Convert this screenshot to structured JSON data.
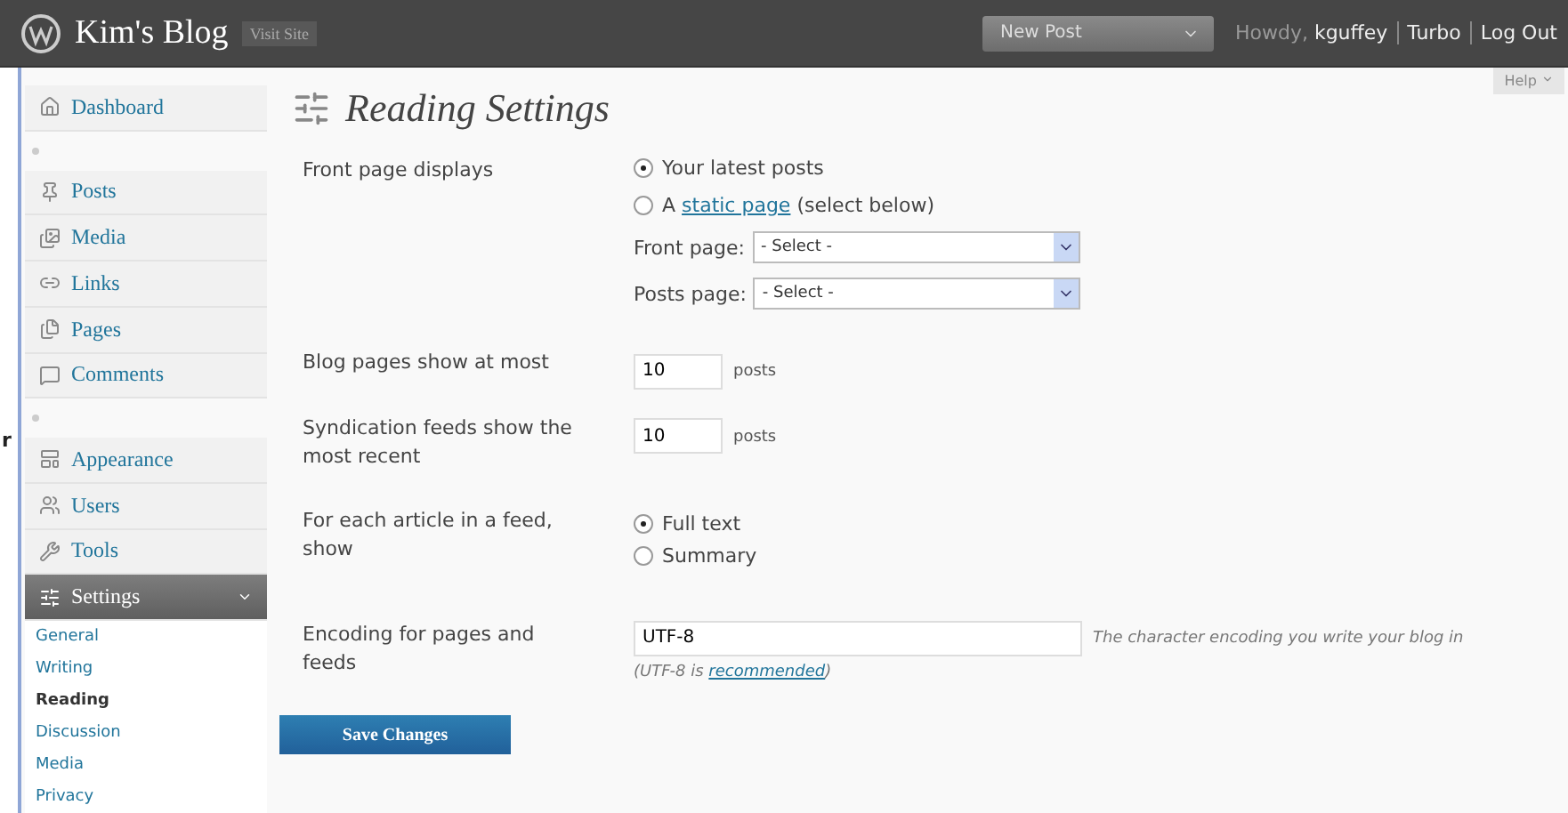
{
  "header": {
    "site_title": "Kim's Blog",
    "visit_site": "Visit Site",
    "new_post": "New Post",
    "howdy": "Howdy, ",
    "user": "kguffey",
    "turbo": "Turbo",
    "logout": "Log Out"
  },
  "edge_text": "r",
  "help": "Help",
  "sidebar": {
    "groups": [
      [
        {
          "label": "Dashboard",
          "selected": false
        }
      ],
      [
        {
          "label": "Posts",
          "selected": false
        },
        {
          "label": "Media",
          "selected": false
        },
        {
          "label": "Links",
          "selected": false
        },
        {
          "label": "Pages",
          "selected": false
        },
        {
          "label": "Comments",
          "selected": false
        }
      ],
      [
        {
          "label": "Appearance",
          "selected": false
        },
        {
          "label": "Users",
          "selected": false
        },
        {
          "label": "Tools",
          "selected": false
        },
        {
          "label": "Settings",
          "selected": true,
          "expanded": true,
          "children": [
            {
              "label": "General",
              "selected": false
            },
            {
              "label": "Writing",
              "selected": false
            },
            {
              "label": "Reading",
              "selected": true
            },
            {
              "label": "Discussion",
              "selected": false
            },
            {
              "label": "Media",
              "selected": false
            },
            {
              "label": "Privacy",
              "selected": false
            }
          ]
        }
      ]
    ]
  },
  "page_title": "Reading Settings",
  "front_page": {
    "label": "Front page displays",
    "options": [
      {
        "kind": "plain",
        "label": "Your latest posts",
        "selected": true
      },
      {
        "kind": "link",
        "before": "A ",
        "link": "static page",
        "after": " (select below)",
        "selected": false
      }
    ],
    "selects": [
      {
        "label": "Front page:",
        "value": "- Select -"
      },
      {
        "label": "Posts page:",
        "value": "- Select -"
      }
    ]
  },
  "blog_pages": {
    "label": "Blog pages show at most",
    "value": "10",
    "unit": "posts"
  },
  "syndication": {
    "label": "Syndication feeds show the most recent",
    "value": "10",
    "unit": "posts"
  },
  "article_feed": {
    "label": "For each article in a feed, show",
    "options": [
      {
        "label": "Full text",
        "selected": true
      },
      {
        "label": "Summary",
        "selected": false
      }
    ]
  },
  "encoding": {
    "label": "Encoding for pages and feeds",
    "value": "UTF-8",
    "description": "The character encoding you write your blog in",
    "hint_before": "(UTF-8 is ",
    "hint_link": "recommended",
    "hint_after": ")"
  },
  "save_button": "Save Changes"
}
